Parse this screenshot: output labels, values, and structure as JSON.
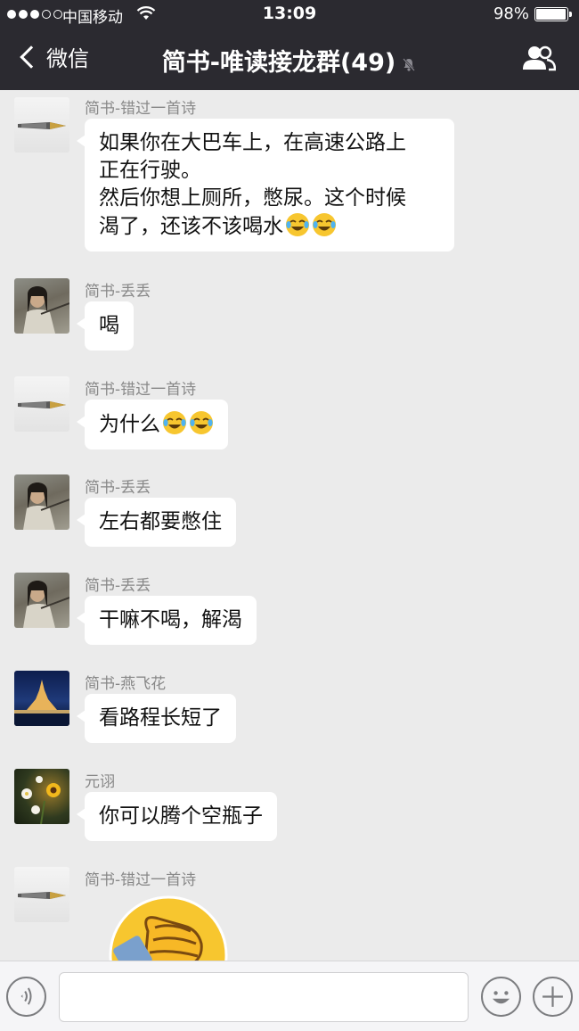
{
  "status_bar": {
    "carrier": "中国移动",
    "time": "13:09",
    "battery_percent": "98%",
    "battery_level": 0.98,
    "signal_icon": "signal-dots-icon",
    "wifi_icon": "wifi-icon"
  },
  "nav": {
    "back_label": "微信",
    "title": "简书-唯读接龙群(49)",
    "muted_icon": "mute-bell-icon",
    "group_icon": "group-members-icon"
  },
  "messages": [
    {
      "sender": "简书-错过一首诗",
      "avatar": "pen-avatar",
      "lines": [
        "如果你在大巴车上，在高速公路上",
        "正在行驶。",
        "然后你想上厕所，憋尿。这个时候",
        "渴了，还该不该喝水"
      ],
      "emojis": 2
    },
    {
      "sender": "简书-丢丢",
      "avatar": "man-avatar",
      "lines": [
        "喝"
      ],
      "emojis": 0
    },
    {
      "sender": "简书-错过一首诗",
      "avatar": "pen-avatar",
      "lines": [
        "为什么"
      ],
      "emojis": 2
    },
    {
      "sender": "简书-丢丢",
      "avatar": "man-avatar",
      "lines": [
        "左右都要憋住"
      ],
      "emojis": 0
    },
    {
      "sender": "简书-丢丢",
      "avatar": "man-avatar",
      "lines": [
        "干嘛不喝，解渴"
      ],
      "emojis": 0
    },
    {
      "sender": "简书-燕飞花",
      "avatar": "castle-avatar",
      "lines": [
        "看路程长短了"
      ],
      "emojis": 0
    },
    {
      "sender": "元诩",
      "avatar": "flower-avatar",
      "lines": [
        "你可以腾个空瓶子"
      ],
      "emojis": 0
    },
    {
      "sender": "简书-错过一首诗",
      "avatar": "pen-avatar",
      "sticker": "facepalm-sticker"
    }
  ],
  "input_bar": {
    "value": "",
    "voice_icon": "voice-icon",
    "emoji_icon": "emoji-icon",
    "plus_icon": "plus-icon"
  },
  "colors": {
    "header_bg": "#2b2a30",
    "chat_bg": "#ebebeb",
    "bubble_bg": "#ffffff",
    "sender_text": "#888888"
  }
}
